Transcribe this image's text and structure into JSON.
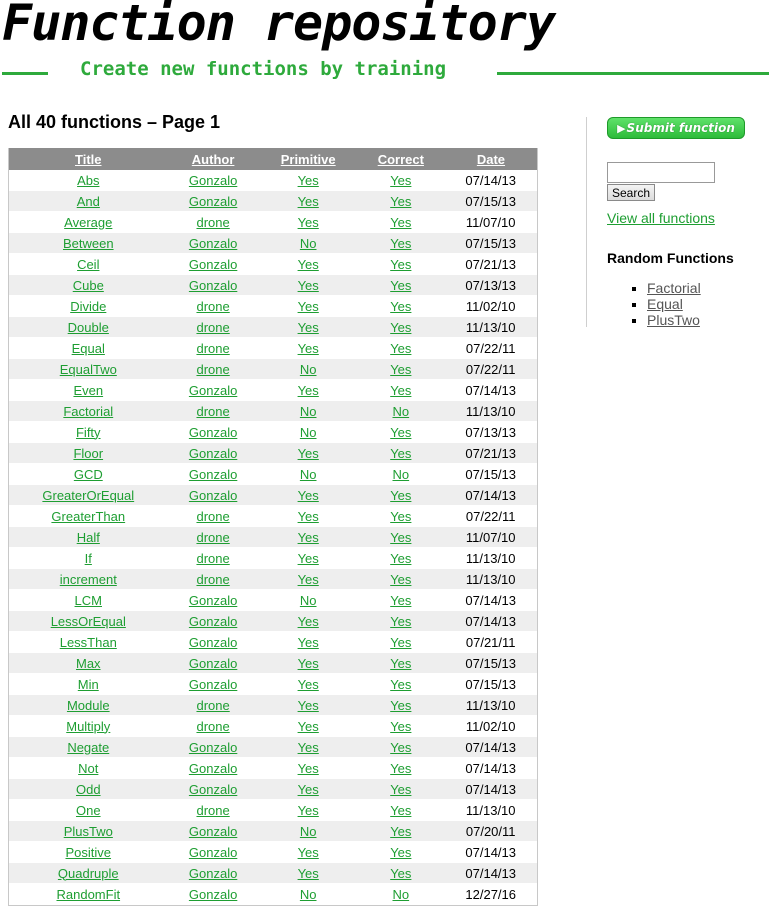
{
  "header": {
    "site_title": "Function repository",
    "tagline": "Create new functions by training"
  },
  "main": {
    "heading": "All 40 functions – Page 1",
    "columns": [
      "Title",
      "Author",
      "Primitive",
      "Correct",
      "Date"
    ],
    "rows": [
      {
        "title": "Abs",
        "author": "Gonzalo",
        "primitive": "Yes",
        "correct": "Yes",
        "date": "07/14/13"
      },
      {
        "title": "And",
        "author": "Gonzalo",
        "primitive": "Yes",
        "correct": "Yes",
        "date": "07/15/13"
      },
      {
        "title": "Average",
        "author": "drone",
        "primitive": "Yes",
        "correct": "Yes",
        "date": "11/07/10"
      },
      {
        "title": "Between",
        "author": "Gonzalo",
        "primitive": "No",
        "correct": "Yes",
        "date": "07/15/13"
      },
      {
        "title": "Ceil",
        "author": "Gonzalo",
        "primitive": "Yes",
        "correct": "Yes",
        "date": "07/21/13"
      },
      {
        "title": "Cube",
        "author": "Gonzalo",
        "primitive": "Yes",
        "correct": "Yes",
        "date": "07/13/13"
      },
      {
        "title": "Divide",
        "author": "drone",
        "primitive": "Yes",
        "correct": "Yes",
        "date": "11/02/10"
      },
      {
        "title": "Double",
        "author": "drone",
        "primitive": "Yes",
        "correct": "Yes",
        "date": "11/13/10"
      },
      {
        "title": "Equal",
        "author": "drone",
        "primitive": "Yes",
        "correct": "Yes",
        "date": "07/22/11"
      },
      {
        "title": "EqualTwo",
        "author": "drone",
        "primitive": "No",
        "correct": "Yes",
        "date": "07/22/11"
      },
      {
        "title": "Even",
        "author": "Gonzalo",
        "primitive": "Yes",
        "correct": "Yes",
        "date": "07/14/13"
      },
      {
        "title": "Factorial",
        "author": "drone",
        "primitive": "No",
        "correct": "No",
        "date": "11/13/10"
      },
      {
        "title": "Fifty",
        "author": "Gonzalo",
        "primitive": "No",
        "correct": "Yes",
        "date": "07/13/13"
      },
      {
        "title": "Floor",
        "author": "Gonzalo",
        "primitive": "Yes",
        "correct": "Yes",
        "date": "07/21/13"
      },
      {
        "title": "GCD",
        "author": "Gonzalo",
        "primitive": "No",
        "correct": "No",
        "date": "07/15/13"
      },
      {
        "title": "GreaterOrEqual",
        "author": "Gonzalo",
        "primitive": "Yes",
        "correct": "Yes",
        "date": "07/14/13"
      },
      {
        "title": "GreaterThan",
        "author": "drone",
        "primitive": "Yes",
        "correct": "Yes",
        "date": "07/22/11"
      },
      {
        "title": "Half",
        "author": "drone",
        "primitive": "Yes",
        "correct": "Yes",
        "date": "11/07/10"
      },
      {
        "title": "If",
        "author": "drone",
        "primitive": "Yes",
        "correct": "Yes",
        "date": "11/13/10"
      },
      {
        "title": "increment",
        "author": "drone",
        "primitive": "Yes",
        "correct": "Yes",
        "date": "11/13/10"
      },
      {
        "title": "LCM",
        "author": "Gonzalo",
        "primitive": "No",
        "correct": "Yes",
        "date": "07/14/13"
      },
      {
        "title": "LessOrEqual",
        "author": "Gonzalo",
        "primitive": "Yes",
        "correct": "Yes",
        "date": "07/14/13"
      },
      {
        "title": "LessThan",
        "author": "Gonzalo",
        "primitive": "Yes",
        "correct": "Yes",
        "date": "07/21/11"
      },
      {
        "title": "Max",
        "author": "Gonzalo",
        "primitive": "Yes",
        "correct": "Yes",
        "date": "07/15/13"
      },
      {
        "title": "Min",
        "author": "Gonzalo",
        "primitive": "Yes",
        "correct": "Yes",
        "date": "07/15/13"
      },
      {
        "title": "Module",
        "author": "drone",
        "primitive": "Yes",
        "correct": "Yes",
        "date": "11/13/10"
      },
      {
        "title": "Multiply",
        "author": "drone",
        "primitive": "Yes",
        "correct": "Yes",
        "date": "11/02/10"
      },
      {
        "title": "Negate",
        "author": "Gonzalo",
        "primitive": "Yes",
        "correct": "Yes",
        "date": "07/14/13"
      },
      {
        "title": "Not",
        "author": "Gonzalo",
        "primitive": "Yes",
        "correct": "Yes",
        "date": "07/14/13"
      },
      {
        "title": "Odd",
        "author": "Gonzalo",
        "primitive": "Yes",
        "correct": "Yes",
        "date": "07/14/13"
      },
      {
        "title": "One",
        "author": "drone",
        "primitive": "Yes",
        "correct": "Yes",
        "date": "11/13/10"
      },
      {
        "title": "PlusTwo",
        "author": "Gonzalo",
        "primitive": "No",
        "correct": "Yes",
        "date": "07/20/11"
      },
      {
        "title": "Positive",
        "author": "Gonzalo",
        "primitive": "Yes",
        "correct": "Yes",
        "date": "07/14/13"
      },
      {
        "title": "Quadruple",
        "author": "Gonzalo",
        "primitive": "Yes",
        "correct": "Yes",
        "date": "07/14/13"
      },
      {
        "title": "RandomFit",
        "author": "Gonzalo",
        "primitive": "No",
        "correct": "No",
        "date": "12/27/16"
      }
    ]
  },
  "sidebar": {
    "submit_label": "Submit function",
    "submit_icon": "play-icon",
    "search_value": "",
    "search_button_label": "Search",
    "view_all_label": "View all functions",
    "random_heading": "Random Functions",
    "random_items": [
      "Factorial",
      "Equal",
      "PlusTwo"
    ]
  },
  "colors": {
    "accent_green": "#2eaa3c",
    "link_green": "#1e9e32",
    "table_header_bg": "#8c8c8c",
    "row_alt_bg": "#eeeeee",
    "random_link": "#555555"
  }
}
